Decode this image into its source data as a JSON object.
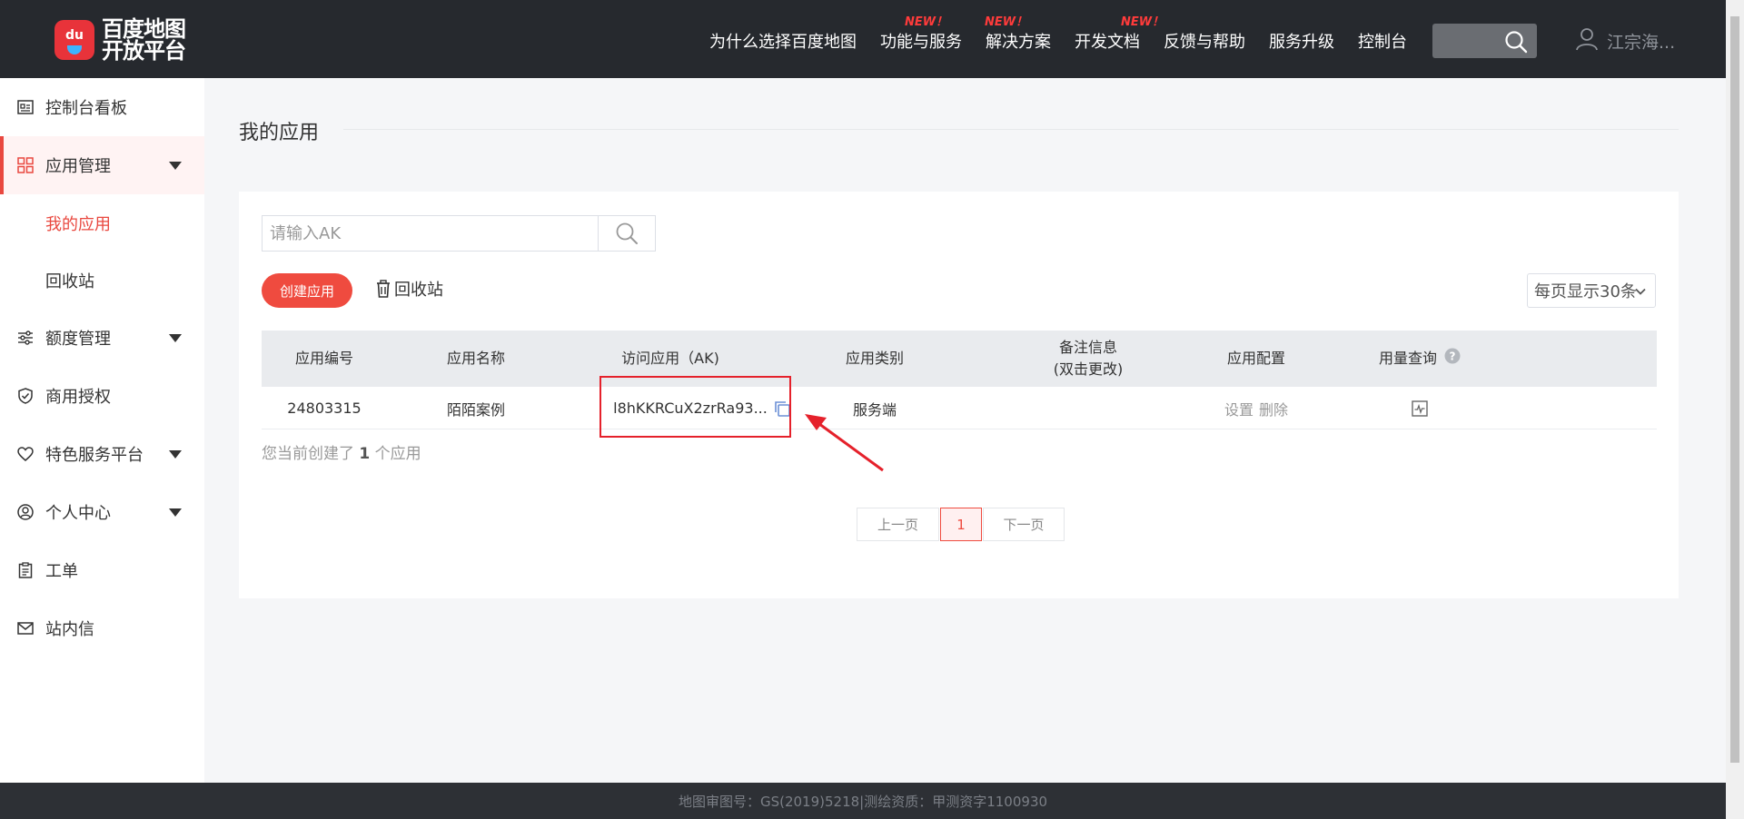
{
  "header": {
    "logo_line1": "百度地图",
    "logo_line2": "开放平台",
    "logo_badge": "du",
    "nav": [
      {
        "label": "为什么选择百度地图",
        "badge": ""
      },
      {
        "label": "功能与服务",
        "badge": "NEW！"
      },
      {
        "label": "解决方案",
        "badge": "NEW！"
      },
      {
        "label": "开发文档",
        "badge": "NEW！"
      },
      {
        "label": "反馈与帮助",
        "badge": ""
      },
      {
        "label": "服务升级",
        "badge": ""
      },
      {
        "label": "控制台",
        "badge": ""
      }
    ],
    "user_name": "江宗海..."
  },
  "sidebar": {
    "items": [
      {
        "label": "控制台看板",
        "icon": "dashboard-icon"
      },
      {
        "label": "应用管理",
        "icon": "grid-icon"
      },
      {
        "label": "额度管理",
        "icon": "sliders-icon"
      },
      {
        "label": "商用授权",
        "icon": "shield-check-icon"
      },
      {
        "label": "特色服务平台",
        "icon": "diamond-icon"
      },
      {
        "label": "个人中心",
        "icon": "user-circle-icon"
      },
      {
        "label": "工单",
        "icon": "clipboard-icon"
      },
      {
        "label": "站内信",
        "icon": "mail-icon"
      }
    ],
    "sub_items": [
      "我的应用",
      "回收站"
    ]
  },
  "main": {
    "page_title": "我的应用",
    "search_placeholder": "请输入AK",
    "create_button": "创建应用",
    "recycle_label": "回收站",
    "per_page": "每页显示30条",
    "columns": [
      "应用编号",
      "应用名称",
      "访问应用（AK)",
      "应用类别",
      "备注信息",
      "(双击更改)",
      "应用配置",
      "用量查询"
    ],
    "rows": [
      {
        "id": "24803315",
        "name": "陌陌案例",
        "ak": "l8hKKRCuX2zrRa93...",
        "type": "服务端",
        "remark": "",
        "settings": "设置",
        "delete": "删除"
      }
    ],
    "count_prefix": "您当前创建了",
    "count_value": "1",
    "count_suffix": "个应用",
    "pager": {
      "prev": "上一页",
      "current": "1",
      "next": "下一页"
    }
  },
  "footer": {
    "text": "地图审图号：GS(2019)5218|测绘资质：甲测资字1100930"
  },
  "colors": {
    "accent": "#ef4b3f",
    "header_bg": "#26292e",
    "annotation": "#e5212b"
  }
}
